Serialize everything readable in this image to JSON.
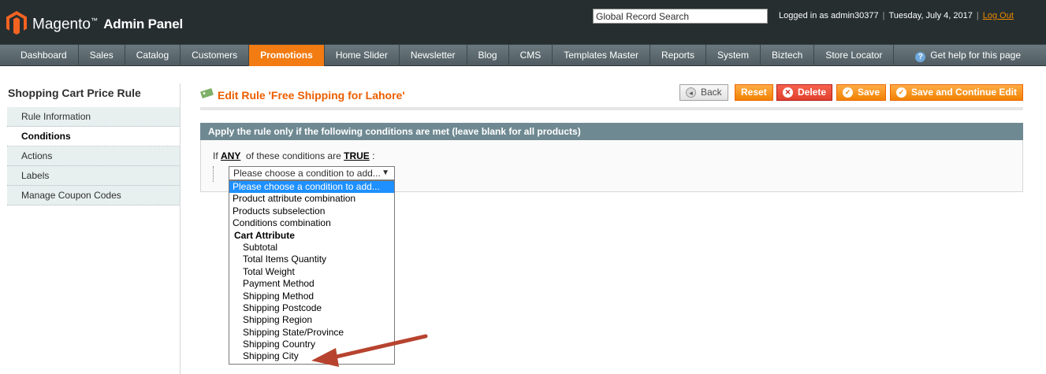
{
  "header": {
    "logo_brand": "Magento",
    "logo_sub": "Admin Panel",
    "search_value": "Global Record Search",
    "logged_in": "Logged in as admin30377",
    "date": "Tuesday, July 4, 2017",
    "logout": "Log Out"
  },
  "nav": {
    "items": [
      "Dashboard",
      "Sales",
      "Catalog",
      "Customers",
      "Promotions",
      "Home Slider",
      "Newsletter",
      "Blog",
      "CMS",
      "Templates Master",
      "Reports",
      "System",
      "Biztech",
      "Store Locator"
    ],
    "active": "Promotions",
    "help": "Get help for this page"
  },
  "sidebar": {
    "title": "Shopping Cart Price Rule",
    "tabs": [
      "Rule Information",
      "Conditions",
      "Actions",
      "Labels",
      "Manage Coupon Codes"
    ],
    "active_tab": "Conditions"
  },
  "content": {
    "title": "Edit Rule 'Free Shipping for Lahore'",
    "buttons": {
      "back": "Back",
      "reset": "Reset",
      "delete": "Delete",
      "save": "Save",
      "save_continue": "Save and Continue Edit"
    },
    "fieldset_title": "Apply the rule only if the following conditions are met (leave blank for all products)",
    "cond_if": "If",
    "cond_any": "ANY",
    "cond_mid": "of these conditions are",
    "cond_true": "TRUE",
    "cond_end": ":",
    "select_value": "Please choose a condition to add..."
  },
  "dropdown": {
    "options": [
      {
        "label": "Please choose a condition to add...",
        "kind": "selected"
      },
      {
        "label": "Product attribute combination",
        "kind": "top"
      },
      {
        "label": "Products subselection",
        "kind": "top"
      },
      {
        "label": "Conditions combination",
        "kind": "top"
      },
      {
        "label": "Cart Attribute",
        "kind": "group"
      },
      {
        "label": "Subtotal",
        "kind": "sub"
      },
      {
        "label": "Total Items Quantity",
        "kind": "sub"
      },
      {
        "label": "Total Weight",
        "kind": "sub"
      },
      {
        "label": "Payment Method",
        "kind": "sub"
      },
      {
        "label": "Shipping Method",
        "kind": "sub"
      },
      {
        "label": "Shipping Postcode",
        "kind": "sub"
      },
      {
        "label": "Shipping Region",
        "kind": "sub"
      },
      {
        "label": "Shipping State/Province",
        "kind": "sub"
      },
      {
        "label": "Shipping Country",
        "kind": "sub"
      },
      {
        "label": "Shipping City",
        "kind": "sub"
      }
    ]
  },
  "colors": {
    "accent": "#f27b12",
    "header_bg": "#262e30",
    "fieldset_head": "#6f8992",
    "annotation_arrow": "#b7432f"
  }
}
